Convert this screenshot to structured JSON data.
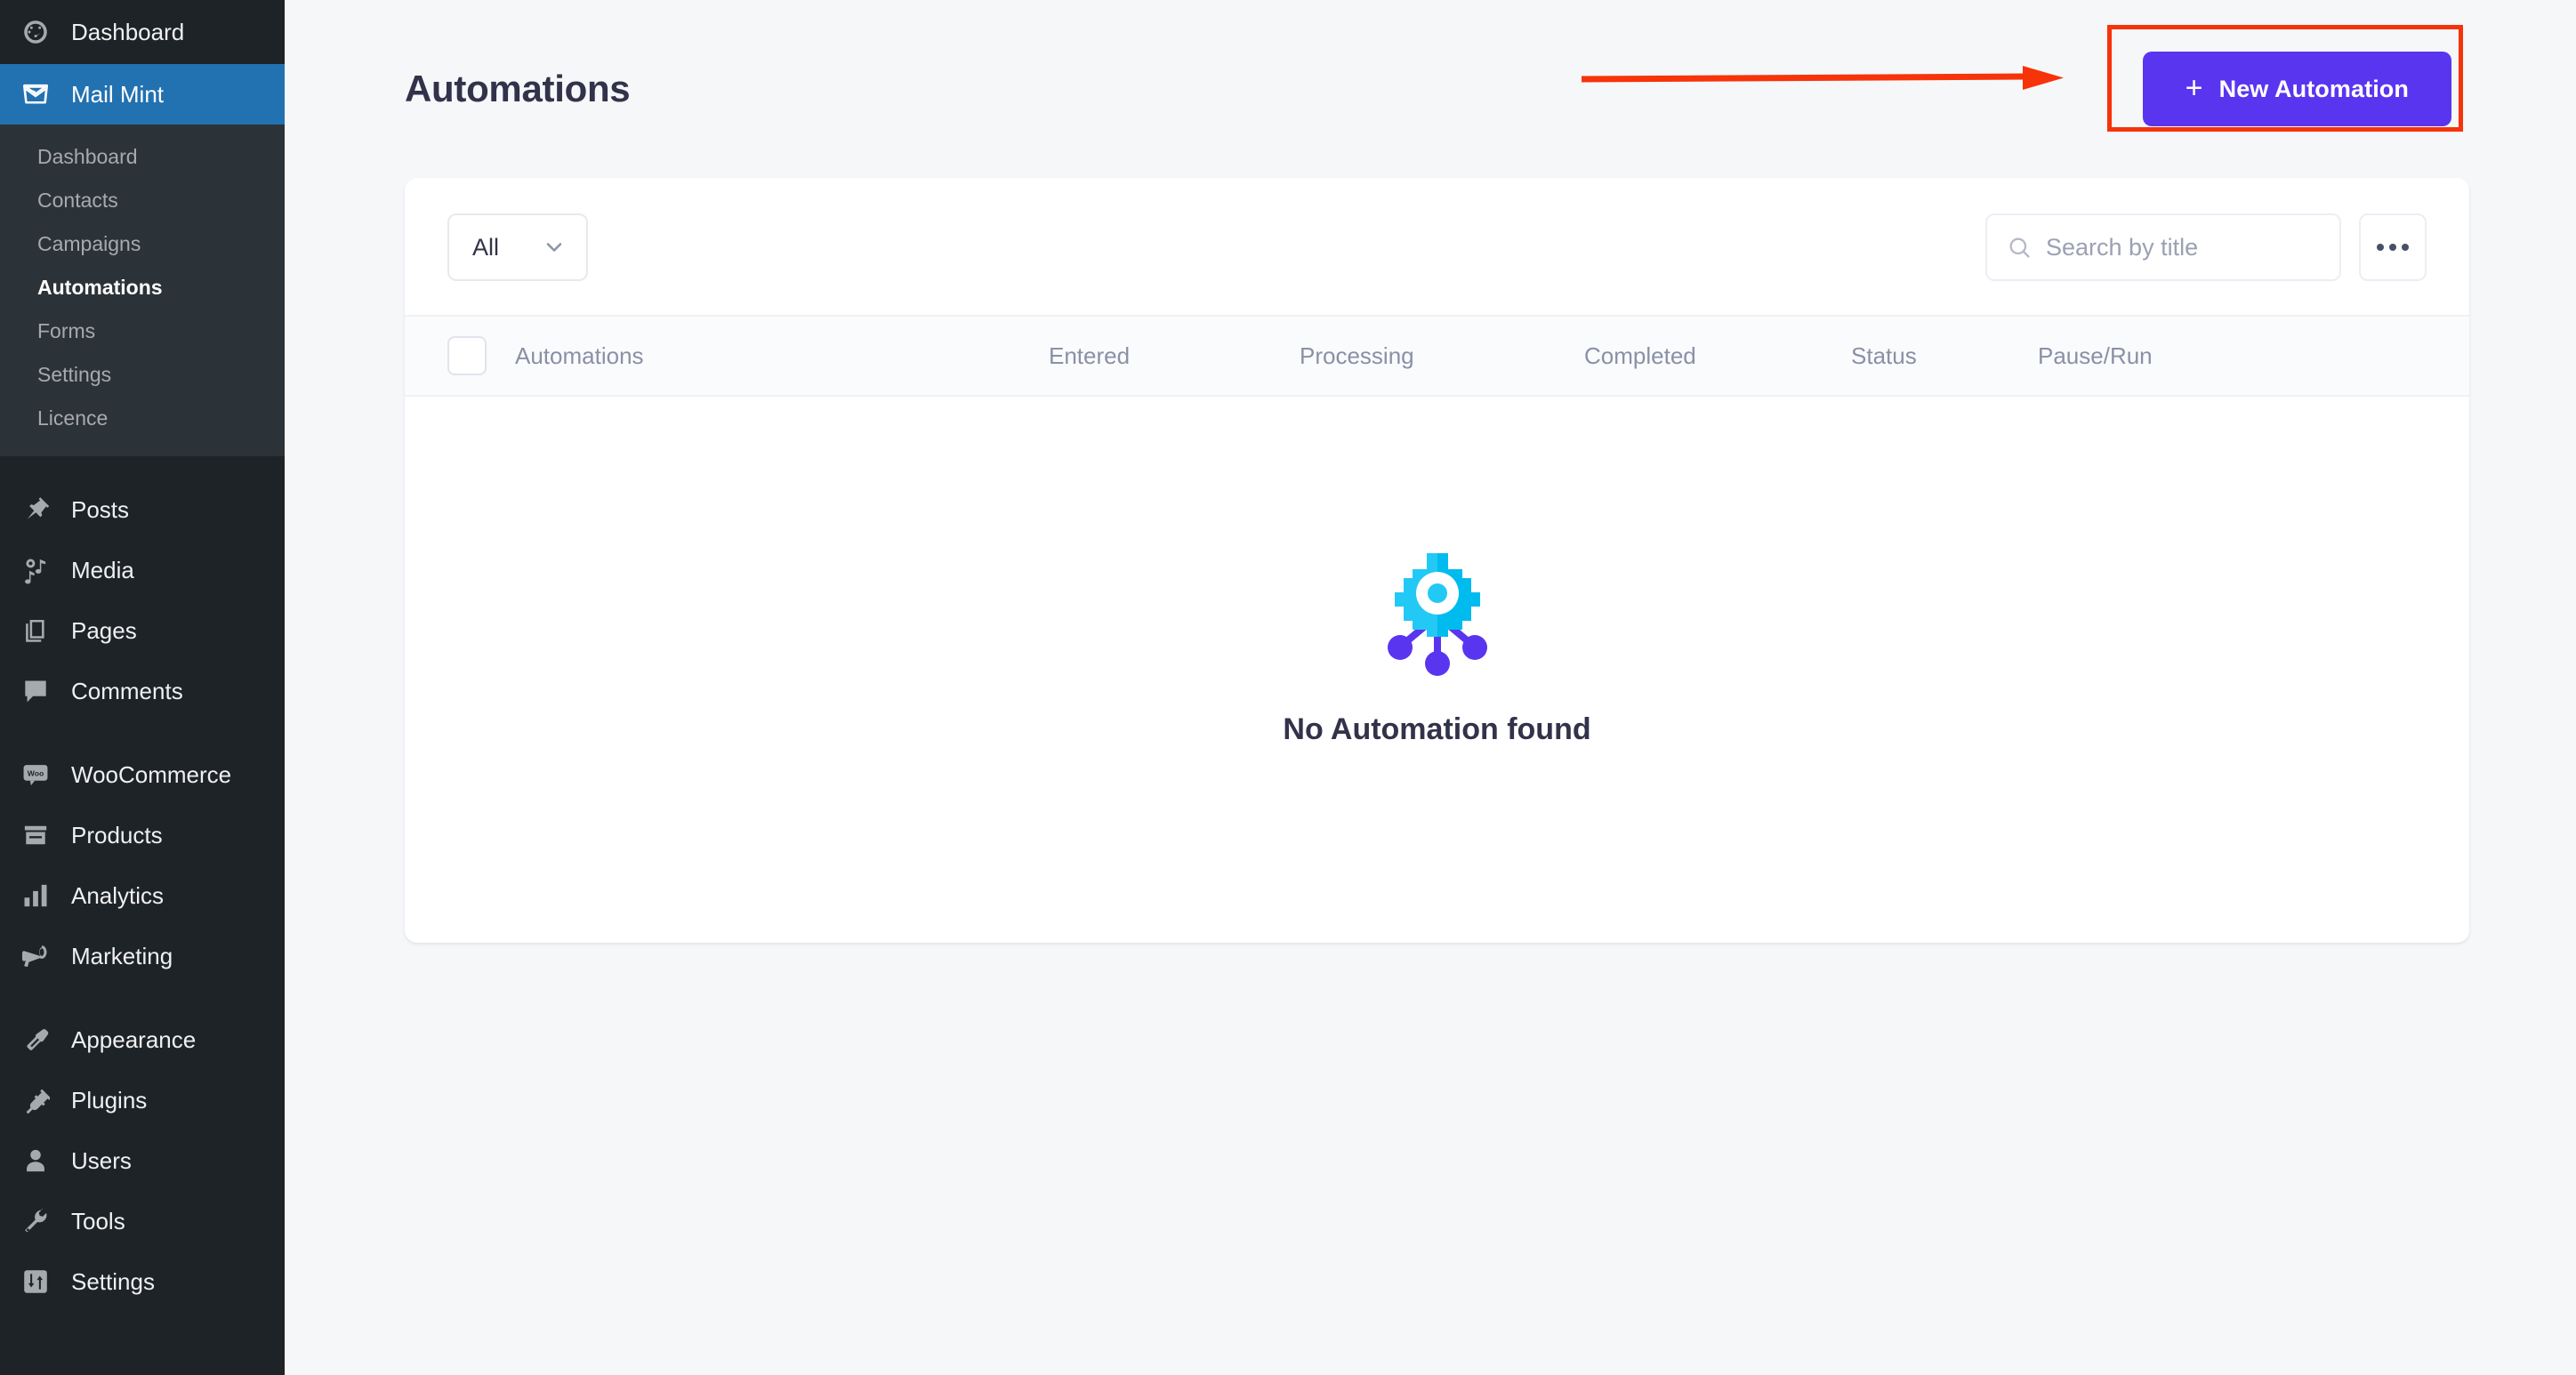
{
  "sidebar": {
    "top_items": [
      {
        "label": "Dashboard",
        "icon": "dashboard-icon",
        "active": false
      }
    ],
    "plugin": {
      "label": "Mail Mint",
      "icon": "envelope-icon",
      "active": true,
      "submenu": [
        {
          "label": "Dashboard",
          "current": false
        },
        {
          "label": "Contacts",
          "current": false
        },
        {
          "label": "Campaigns",
          "current": false
        },
        {
          "label": "Automations",
          "current": true
        },
        {
          "label": "Forms",
          "current": false
        },
        {
          "label": "Settings",
          "current": false
        },
        {
          "label": "Licence",
          "current": false
        }
      ]
    },
    "group_content": [
      {
        "label": "Posts",
        "icon": "pin-icon"
      },
      {
        "label": "Media",
        "icon": "media-icon"
      },
      {
        "label": "Pages",
        "icon": "pages-icon"
      },
      {
        "label": "Comments",
        "icon": "comment-icon"
      }
    ],
    "group_commerce": [
      {
        "label": "WooCommerce",
        "icon": "woo-icon"
      },
      {
        "label": "Products",
        "icon": "products-icon"
      },
      {
        "label": "Analytics",
        "icon": "analytics-icon"
      },
      {
        "label": "Marketing",
        "icon": "megaphone-icon"
      }
    ],
    "group_site": [
      {
        "label": "Appearance",
        "icon": "paintbrush-icon"
      },
      {
        "label": "Plugins",
        "icon": "plug-icon"
      },
      {
        "label": "Users",
        "icon": "user-icon"
      },
      {
        "label": "Tools",
        "icon": "wrench-icon"
      },
      {
        "label": "Settings",
        "icon": "sliders-icon"
      }
    ]
  },
  "header": {
    "title": "Automations",
    "new_automation_label": "New Automation",
    "new_automation_plus": "+"
  },
  "toolbar": {
    "filter_value": "All",
    "search_placeholder": "Search by title",
    "search_value": "",
    "more_label": "..."
  },
  "table": {
    "columns": [
      "Automations",
      "Entered",
      "Processing",
      "Completed",
      "Status",
      "Pause/Run"
    ]
  },
  "empty": {
    "message": "No Automation found",
    "illustration": "automation-gear-nodes-icon"
  },
  "colors": {
    "accent": "#5a35f0",
    "sidebar_bg": "#1d2327",
    "submenu_bg": "#2c3338",
    "sidebar_active": "#2271b1",
    "page_bg": "#f6f7f9",
    "annotation": "#f7330a",
    "gear_cyan": "#22c9f5",
    "gear_cyan_dark": "#00bbee",
    "node_purple": "#5a35f0",
    "heading_text": "#32324a"
  }
}
